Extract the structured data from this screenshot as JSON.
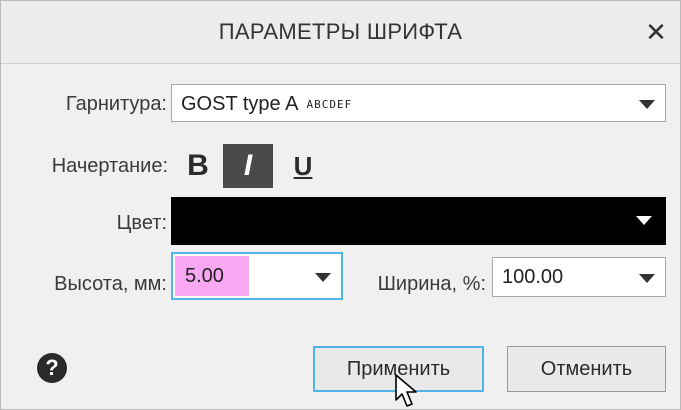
{
  "dialog": {
    "title": "ПАРАМЕТРЫ ШРИФТА",
    "close_icon": "close-icon"
  },
  "typeface": {
    "label": "Гарнитура:",
    "value": "GOST type A",
    "sample": "ABCDEF"
  },
  "style": {
    "label": "Начертание:",
    "bold": "B",
    "italic": "I",
    "underline": "U",
    "italic_selected": true
  },
  "color": {
    "label": "Цвет:",
    "value_hex": "#000000"
  },
  "height": {
    "label": "Высота, мм:",
    "value": "5.00"
  },
  "width": {
    "label": "Ширина, %:",
    "value": "100.00"
  },
  "buttons": {
    "help": "?",
    "apply": "Применить",
    "cancel": "Отменить"
  },
  "colors": {
    "accent": "#51b4e6",
    "highlight": "#f8a8f3",
    "selected_style_bg": "#4a4a4a"
  }
}
